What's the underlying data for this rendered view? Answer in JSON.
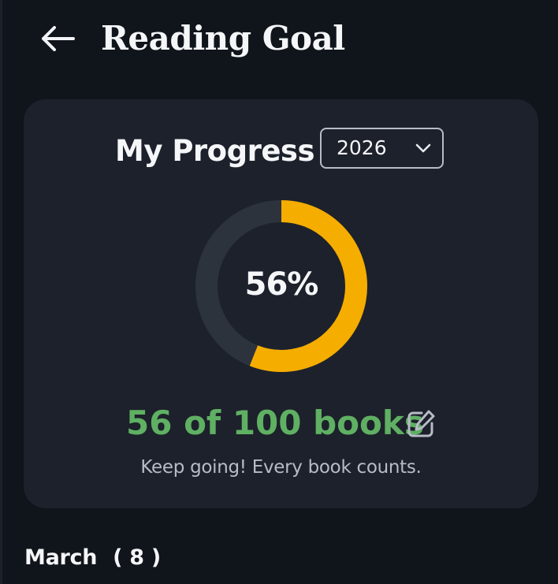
{
  "header": {
    "title": "Reading Goal",
    "back_icon": "arrow-left-icon"
  },
  "progress_card": {
    "title": "My Progress",
    "year_select": {
      "value": "2026",
      "icon": "chevron-down-icon"
    },
    "percent_label": "56%",
    "percent_value": 0.56,
    "books_text": "56 of 100 books",
    "edit_icon": "edit-icon",
    "message": "Keep going! Every book counts."
  },
  "section": {
    "label": "March",
    "count": "( 8 )"
  },
  "colors": {
    "background": "#10141b",
    "card": "#1d212b",
    "ring_track": "#2d333d",
    "ring_progress": "#f5ad00",
    "success_text": "#5fb063"
  }
}
